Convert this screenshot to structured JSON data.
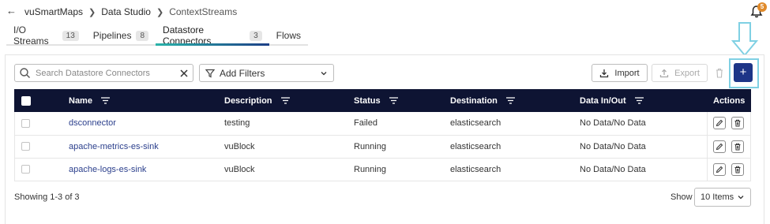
{
  "breadcrumb": {
    "items": [
      "vuSmartMaps",
      "Data Studio",
      "ContextStreams"
    ]
  },
  "notifications": {
    "count": "5"
  },
  "tabs": [
    {
      "label": "I/O Streams",
      "count": "13"
    },
    {
      "label": "Pipelines",
      "count": "8"
    },
    {
      "label": "Datastore Connectors",
      "count": "3"
    },
    {
      "label": "Flows",
      "count": ""
    }
  ],
  "toolbar": {
    "search_placeholder": "Search Datastore Connectors",
    "filters_label": "Add Filters",
    "import_label": "Import",
    "export_label": "Export",
    "add_label": "+"
  },
  "table": {
    "headers": [
      "Name",
      "Description",
      "Status",
      "Destination",
      "Data In/Out",
      "Actions"
    ],
    "rows": [
      {
        "name": "dsconnector",
        "description": "testing",
        "status": "Failed",
        "destination": "elasticsearch",
        "data": "No Data/No Data"
      },
      {
        "name": "apache-metrics-es-sink",
        "description": "vuBlock",
        "status": "Running",
        "destination": "elasticsearch",
        "data": "No Data/No Data"
      },
      {
        "name": "apache-logs-es-sink",
        "description": "vuBlock",
        "status": "Running",
        "destination": "elasticsearch",
        "data": "No Data/No Data"
      }
    ]
  },
  "footer": {
    "showing": "Showing 1-3 of 3",
    "show_label": "Show",
    "items_value": "10 Items"
  },
  "colors": {
    "header_bg": "#0e1433",
    "accent": "#1d3587",
    "highlight": "#7fd0e3",
    "badge": "#e08a2a"
  }
}
